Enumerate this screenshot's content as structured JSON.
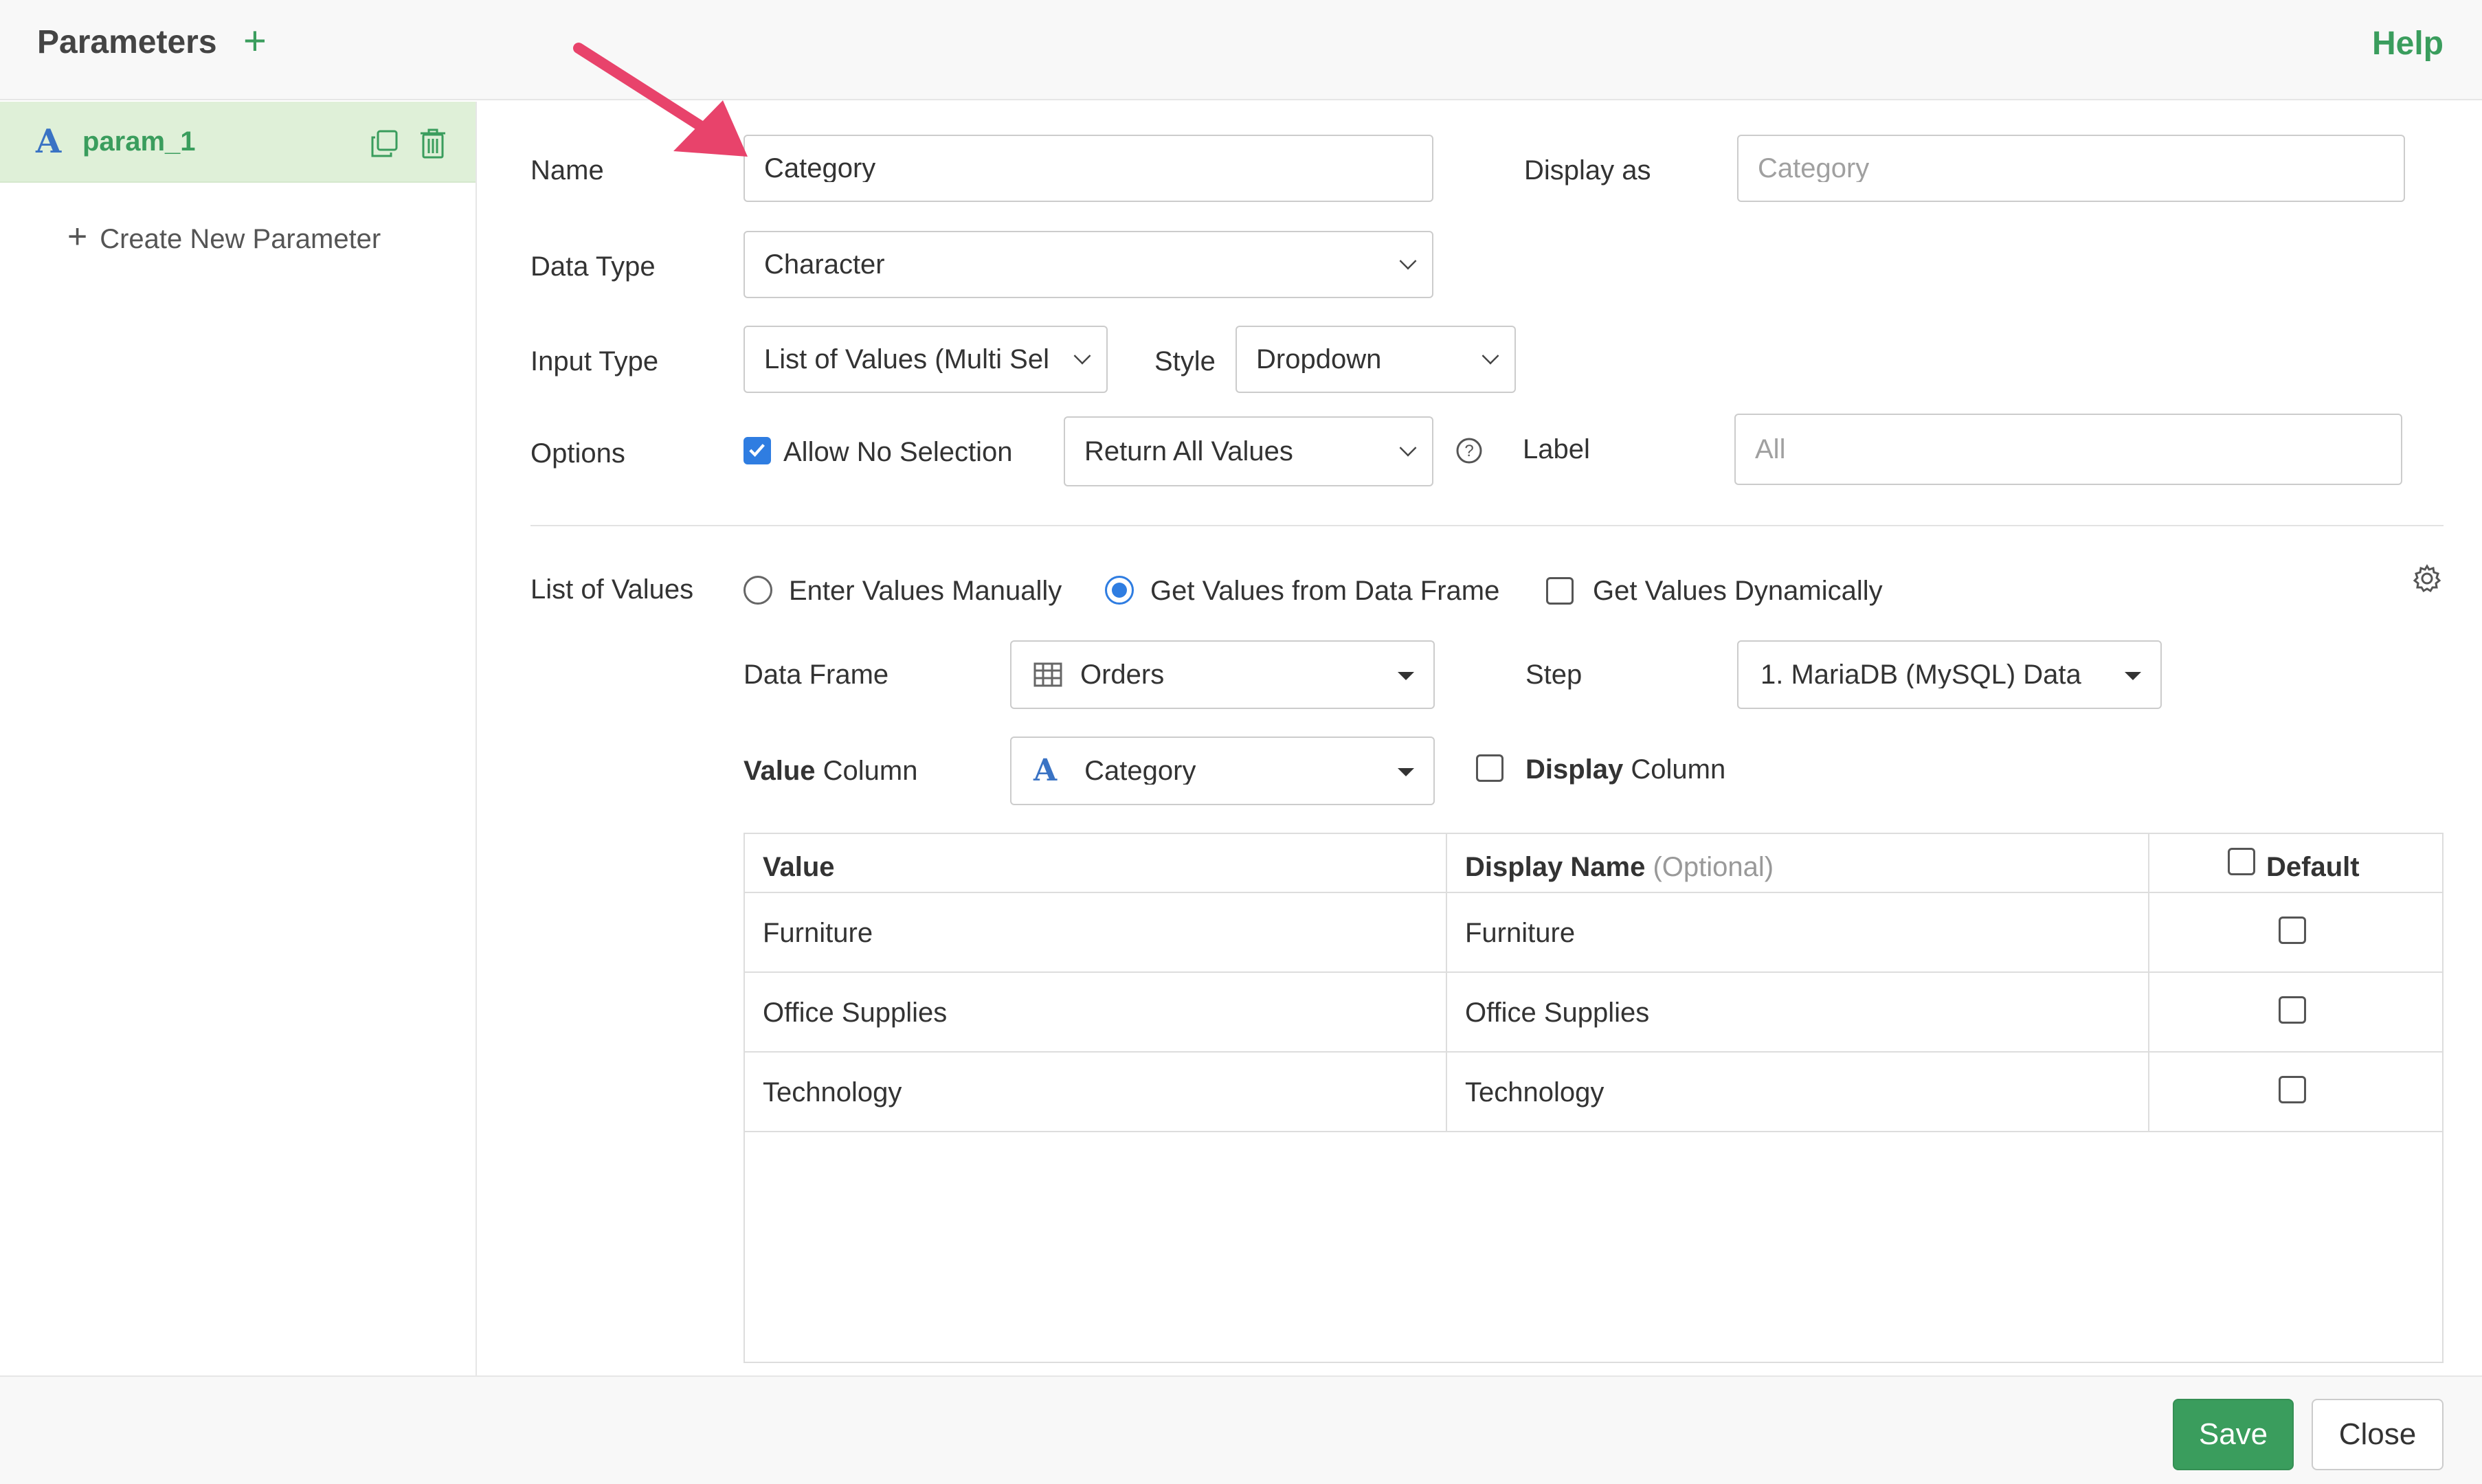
{
  "header": {
    "title": "Parameters",
    "add_glyph": "+",
    "help": "Help"
  },
  "sidebar": {
    "items": [
      {
        "type_glyph": "A",
        "name": "param_1"
      }
    ],
    "create_new": "Create New Parameter",
    "create_glyph": "+"
  },
  "form": {
    "name_label": "Name",
    "name_value": "Category",
    "display_as_label": "Display as",
    "display_as_placeholder": "Category",
    "data_type_label": "Data Type",
    "data_type_value": "Character",
    "input_type_label": "Input Type",
    "input_type_value": "List of Values (Multi Sel",
    "style_label": "Style",
    "style_value": "Dropdown",
    "options_label": "Options",
    "allow_no_selection": "Allow No Selection",
    "allow_no_selection_checked": true,
    "return_value": "Return All Values",
    "help_glyph": "?",
    "label_label": "Label",
    "label_placeholder": "All"
  },
  "list_of_values": {
    "label": "List of Values",
    "options": [
      "Enter Values Manually",
      "Get Values from Data Frame",
      "Get Values Dynamically"
    ],
    "selected": "Get Values from Data Frame",
    "data_frame_label": "Data Frame",
    "data_frame_value": "Orders",
    "step_label": "Step",
    "step_value": "1. MariaDB (MySQL) Data",
    "value_column_bold": "Value",
    "value_column_rest": " Column",
    "value_column_type_glyph": "A",
    "value_column_value": "Category",
    "display_column_bold": "Display",
    "display_column_rest": " Column"
  },
  "table": {
    "headers": {
      "value": "Value",
      "display_name": "Display Name",
      "display_name_optional": "(Optional)",
      "default": "Default"
    },
    "rows": [
      {
        "value": "Furniture",
        "display": "Furniture"
      },
      {
        "value": "Office Supplies",
        "display": "Office Supplies"
      },
      {
        "value": "Technology",
        "display": "Technology"
      }
    ]
  },
  "footer": {
    "save": "Save",
    "close": "Close"
  },
  "colors": {
    "accent_green": "#3a9d5d",
    "selected_bg": "#dff0d8",
    "check_blue": "#2f7de1",
    "annotation_arrow": "#e8436b"
  },
  "icons": [
    "plus-icon",
    "type-character-icon",
    "copy-icon",
    "trash-icon",
    "chevron-down-icon",
    "caret-down-icon",
    "help-circle-icon",
    "gear-icon",
    "grid-table-icon",
    "annotation-arrow"
  ]
}
